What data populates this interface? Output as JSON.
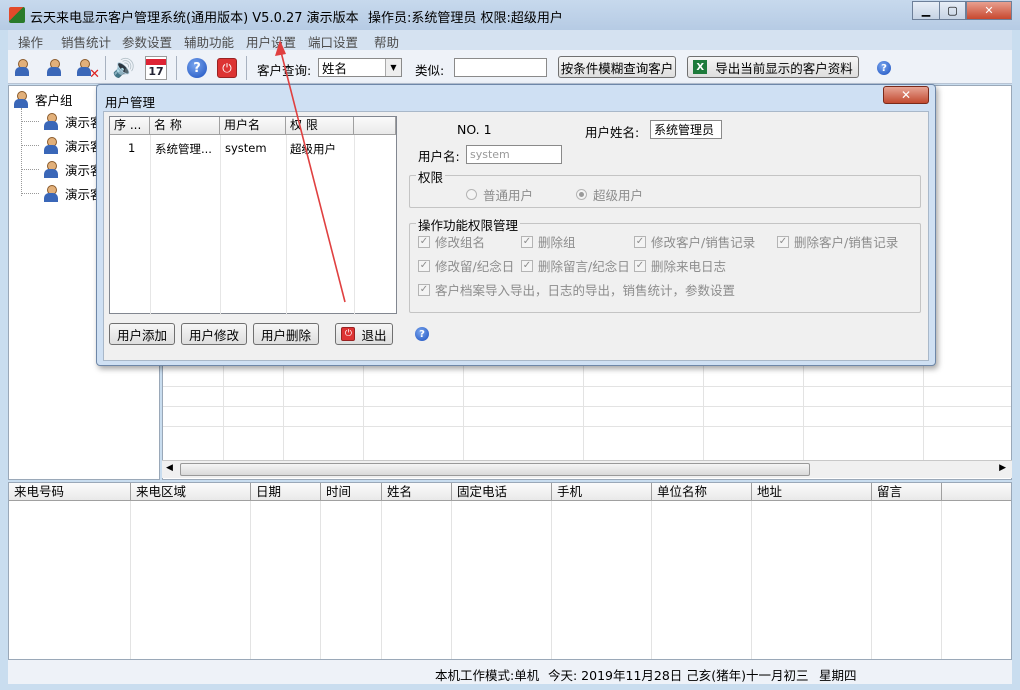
{
  "window": {
    "title": "云天来电显示客户管理系统(通用版本) V5.0.27  演示版本",
    "operator": "操作员:系统管理员  权限:超级用户"
  },
  "menu": [
    "操作",
    "销售统计",
    "参数设置",
    "辅助功能",
    "用户设置",
    "端口设置",
    "帮助"
  ],
  "toolbar": {
    "query_label": "客户查询:",
    "query_field_value": "姓名",
    "like_label": "类似:",
    "like_value": "",
    "fuzzy_query_button": "按条件模糊查询客户",
    "export_button": "导出当前显示的客户资料",
    "calendar_day": "17"
  },
  "tree": {
    "root": "客户组",
    "children": [
      "演示客",
      "演示客",
      "演示客",
      "演示客"
    ]
  },
  "call_log": {
    "columns": [
      "来电号码",
      "来电区域",
      "日期",
      "时间",
      "姓名",
      "固定电话",
      "手机",
      "单位名称",
      "地址",
      "留言"
    ]
  },
  "status": {
    "mode": "本机工作模式:单机",
    "today": "今天: 2019年11月28日  己亥(猪年)十一月初三",
    "weekday": "星期四"
  },
  "dialog": {
    "title": "用户管理",
    "list_columns": [
      "序 ...",
      "名  称",
      "用户名",
      "权  限"
    ],
    "rows": [
      {
        "no": "1",
        "name": "系统管理...",
        "username": "system",
        "role": "超级用户"
      }
    ],
    "record_no": "NO. 1",
    "user_fullname_label": "用户姓名:",
    "user_fullname_value": "系统管理员",
    "username_label": "用户名:",
    "username_value": "system",
    "role_group_title": "权限",
    "role_normal": "普通用户",
    "role_super": "超级用户",
    "perm_group_title": "操作功能权限管理",
    "permissions": [
      "修改组名",
      "删除组",
      "修改客户/销售记录",
      "删除客户/销售记录",
      "修改留/纪念日",
      "删除留言/纪念日",
      "删除来电日志",
      "客户档案导入导出，日志的导出，销售统计，参数设置"
    ],
    "buttons": {
      "add": "用户添加",
      "edit": "用户修改",
      "delete": "用户删除",
      "exit": "退出"
    }
  }
}
